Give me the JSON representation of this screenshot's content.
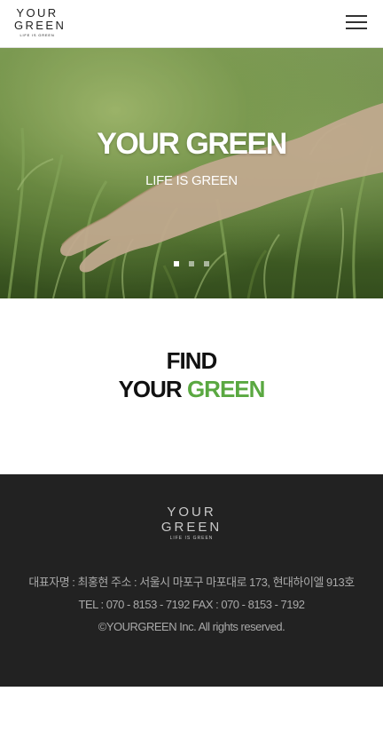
{
  "header": {
    "logo": {
      "line1": "YOUR",
      "line2": "GREEN",
      "tagline": "LIFE IS GREEN"
    },
    "menu_icon": "hamburger-menu-icon"
  },
  "hero": {
    "title": "YOUR GREEN",
    "subtitle": "LIFE IS GREEN",
    "slides_total": 3,
    "active_slide": 1
  },
  "find": {
    "line1": "FIND",
    "line2_part1": "YOUR",
    "line2_part2": "GREEN"
  },
  "footer": {
    "logo": {
      "line1": "YOUR",
      "line2": "GREEN",
      "tagline": "LIFE IS GREEN"
    },
    "info_line1": "대표자명 : 최홍현  주소 : 서울시 마포구 마포대로 173, 현대하이엘 913호",
    "info_line2": "TEL : 070 - 8153 - 7192  FAX : 070 - 8153 - 7192",
    "copyright": "©YOURGREEN Inc. All rights reserved."
  },
  "colors": {
    "accent_green": "#5aa841",
    "footer_bg": "#222222",
    "footer_text": "#a9a9a9"
  }
}
